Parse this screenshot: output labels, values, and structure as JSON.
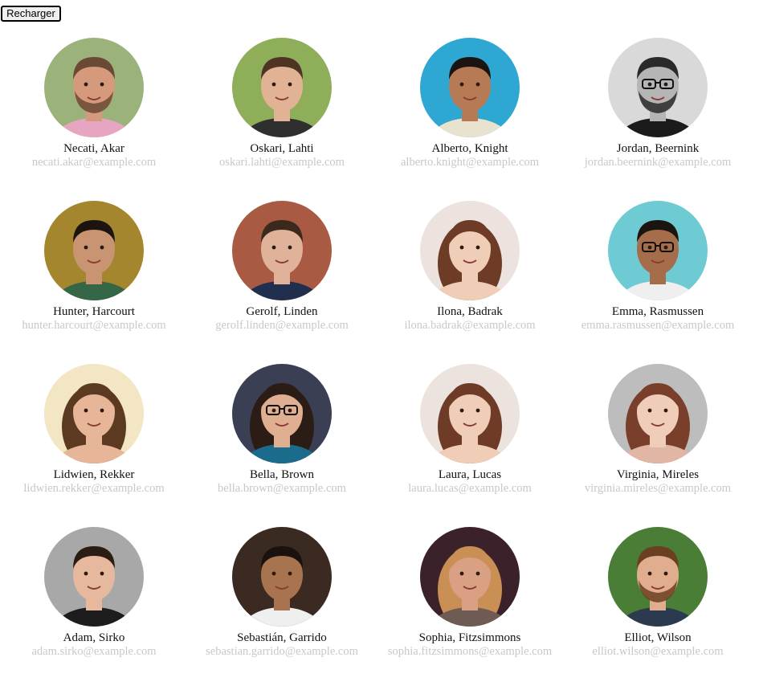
{
  "toolbar": {
    "reload_label": "Recharger"
  },
  "people": [
    {
      "name": "Necati, Akar",
      "email": "necati.akar@example.com",
      "bg": "#9bb27a",
      "skin": "#d59a7c",
      "hair": "#6b4a35",
      "shirt": "#e6a6c2",
      "beard": true,
      "long": false,
      "glasses": false
    },
    {
      "name": "Oskari, Lahti",
      "email": "oskari.lahti@example.com",
      "bg": "#8fae5a",
      "skin": "#e1b294",
      "hair": "#4d3423",
      "shirt": "#2f2f2f",
      "beard": false,
      "long": false,
      "glasses": false
    },
    {
      "name": "Alberto, Knight",
      "email": "alberto.knight@example.com",
      "bg": "#2fa7d3",
      "skin": "#b67a55",
      "hair": "#1c1410",
      "shirt": "#e9e2cf",
      "beard": false,
      "long": false,
      "glasses": false
    },
    {
      "name": "Jordan, Beernink",
      "email": "jordan.beernink@example.com",
      "bg": "#d9d9d9",
      "skin": "#b5b5b5",
      "hair": "#2a2a2a",
      "shirt": "#1b1b1b",
      "beard": true,
      "long": false,
      "glasses": true
    },
    {
      "name": "Hunter, Harcourt",
      "email": "hunter.harcourt@example.com",
      "bg": "#a4862f",
      "skin": "#c99472",
      "hair": "#1b140f",
      "shirt": "#356645",
      "beard": false,
      "long": false,
      "glasses": false
    },
    {
      "name": "Gerolf, Linden",
      "email": "gerolf.linden@example.com",
      "bg": "#a95a43",
      "skin": "#e0b299",
      "hair": "#3b291d",
      "shirt": "#1f2f4d",
      "beard": false,
      "long": false,
      "glasses": false
    },
    {
      "name": "Ilona, Badrak",
      "email": "ilona.badrak@example.com",
      "bg": "#ece3df",
      "skin": "#f0cdb6",
      "hair": "#6e3c26",
      "shirt": "#f0cdb6",
      "beard": false,
      "long": true,
      "glasses": false
    },
    {
      "name": "Emma, Rasmussen",
      "email": "emma.rasmussen@example.com",
      "bg": "#6ecad3",
      "skin": "#a56d4a",
      "hair": "#1b1410",
      "shirt": "#efefef",
      "beard": false,
      "long": false,
      "glasses": true
    },
    {
      "name": "Lidwien, Rekker",
      "email": "lidwien.rekker@example.com",
      "bg": "#f2e6c4",
      "skin": "#e7b597",
      "hair": "#5c3a21",
      "shirt": "#e7b597",
      "beard": false,
      "long": true,
      "glasses": false
    },
    {
      "name": "Bella, Brown",
      "email": "bella.brown@example.com",
      "bg": "#3a3f54",
      "skin": "#e0ae91",
      "hair": "#2b1c16",
      "shirt": "#1b6b8c",
      "beard": false,
      "long": true,
      "glasses": true
    },
    {
      "name": "Laura, Lucas",
      "email": "laura.lucas@example.com",
      "bg": "#ece3df",
      "skin": "#f0cdb6",
      "hair": "#6e3c26",
      "shirt": "#f0cdb6",
      "beard": false,
      "long": true,
      "glasses": false
    },
    {
      "name": "Virginia, Mireles",
      "email": "virginia.mireles@example.com",
      "bg": "#bdbdbd",
      "skin": "#efcdb8",
      "hair": "#7a3f2a",
      "shirt": "#e2b6a5",
      "beard": false,
      "long": true,
      "glasses": false
    },
    {
      "name": "Adam, Sirko",
      "email": "adam.sirko@example.com",
      "bg": "#a8a8a8",
      "skin": "#e6b89e",
      "hair": "#2a1d14",
      "shirt": "#1d1d1d",
      "beard": false,
      "long": false,
      "glasses": false
    },
    {
      "name": "Sebastián, Garrido",
      "email": "sebastian.garrido@example.com",
      "bg": "#3a2a22",
      "skin": "#a7744f",
      "hair": "#1a120e",
      "shirt": "#efefef",
      "beard": false,
      "long": false,
      "glasses": false
    },
    {
      "name": "Sophia, Fitzsimmons",
      "email": "sophia.fitzsimmons@example.com",
      "bg": "#3b2129",
      "skin": "#d9a083",
      "hair": "#c98f54",
      "shirt": "#6e5b53",
      "beard": false,
      "long": true,
      "glasses": false
    },
    {
      "name": "Elliot, Wilson",
      "email": "elliot.wilson@example.com",
      "bg": "#4a7d35",
      "skin": "#e1ad8f",
      "hair": "#6b3f22",
      "shirt": "#2b3a4f",
      "beard": true,
      "long": false,
      "glasses": false
    }
  ]
}
